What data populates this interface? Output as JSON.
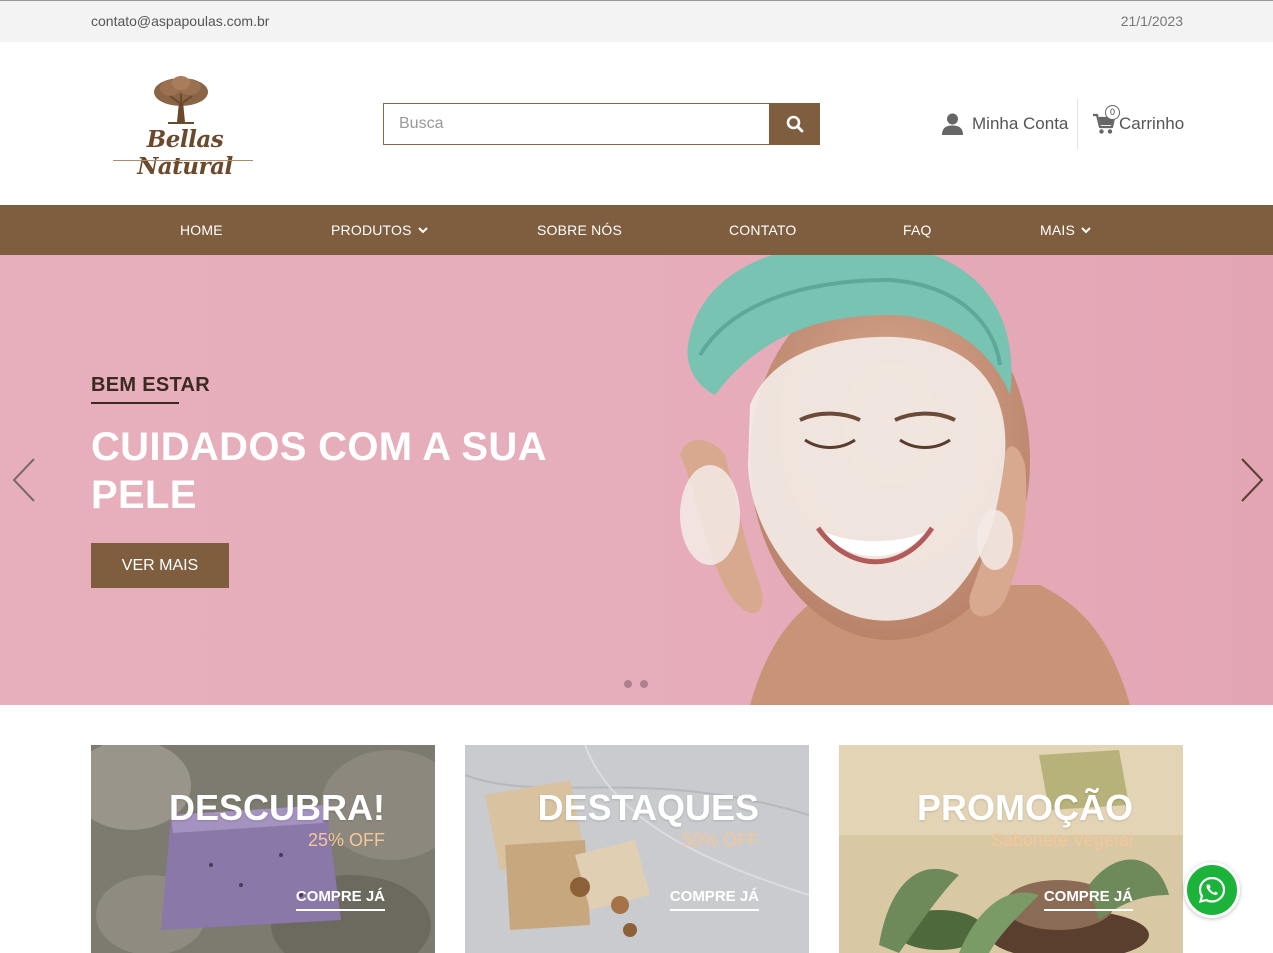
{
  "topbar": {
    "email": "contato@aspapoulas.com.br",
    "date": "21/1/2023"
  },
  "header": {
    "brand": "Bellas Natural",
    "search_placeholder": "Busca",
    "account_label": "Minha Conta",
    "cart_label": "Carrinho",
    "cart_count": "0"
  },
  "nav": {
    "items": [
      {
        "label": "HOME"
      },
      {
        "label": "PRODUTOS",
        "dropdown": true
      },
      {
        "label": "SOBRE NÓS"
      },
      {
        "label": "CONTATO"
      },
      {
        "label": "FAQ"
      },
      {
        "label": "MAIS",
        "dropdown": true
      }
    ]
  },
  "hero": {
    "kicker": "BEM ESTAR",
    "title": "CUIDADOS COM A SUA PELE",
    "cta": "VER MAIS",
    "slides": 2,
    "active_slide": 1
  },
  "promos": [
    {
      "title": "DESCUBRA!",
      "subtitle": "25% OFF",
      "button": "COMPRE JÁ"
    },
    {
      "title": "DESTAQUES",
      "subtitle": "50% OFF",
      "button": "COMPRE JÁ"
    },
    {
      "title": "PROMOÇÃO",
      "subtitle": "Sabonete Vegetal",
      "button": "COMPRE JÁ"
    }
  ],
  "colors": {
    "brand_brown": "#7f5e40",
    "hero_pink": "#e6adbb",
    "accent_peach": "#f4c79a",
    "whatsapp_green": "#1bb33a"
  },
  "icons": [
    "tree-logo-icon",
    "search-icon",
    "user-icon",
    "cart-icon",
    "chevron-down-icon",
    "chevron-left-icon",
    "chevron-right-icon",
    "whatsapp-icon"
  ]
}
